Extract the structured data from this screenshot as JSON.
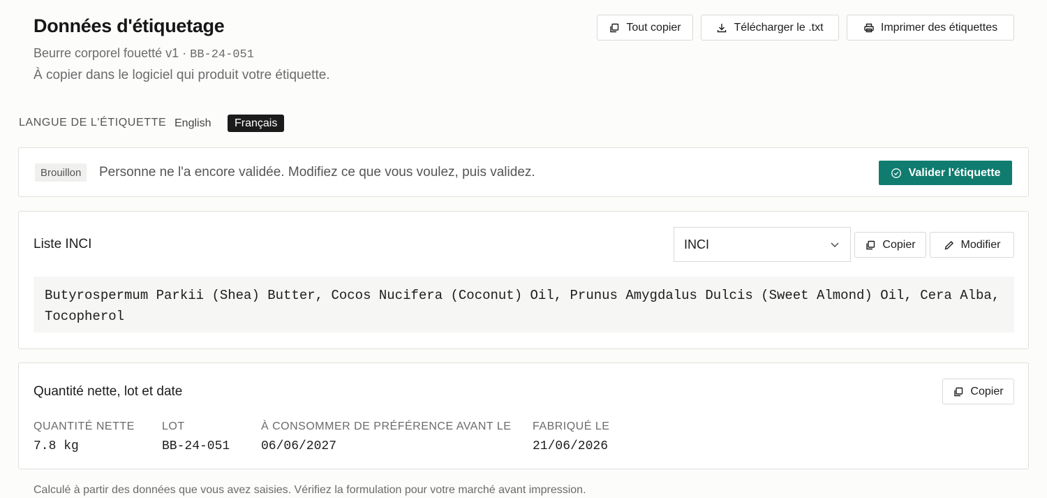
{
  "header": {
    "title": "Données d'étiquetage",
    "subtitle_name": "Beurre corporel fouetté v1 ·",
    "subtitle_code": "BB-24-051",
    "description": "À copier dans le logiciel qui produit votre étiquette."
  },
  "toolbar": {
    "copy_all": "Tout copier",
    "download": "Télécharger le .txt",
    "print": "Imprimer des étiquettes"
  },
  "language": {
    "label": "LANGUE DE L'ÉTIQUETTE",
    "options": [
      "English",
      "Français"
    ],
    "selected": "Français"
  },
  "status": {
    "badge": "Brouillon",
    "message": "Personne ne l'a encore validée. Modifiez ce que vous voulez, puis validez.",
    "validate_label": "Valider l'étiquette"
  },
  "inci": {
    "title": "Liste INCI",
    "select_value": "INCI",
    "copy_label": "Copier",
    "edit_label": "Modifier",
    "list_text": "Butyrospermum Parkii (Shea) Butter, Cocos Nucifera (Coconut) Oil, Prunus Amygdalus Dulcis (Sweet Almond) Oil, Cera Alba, Tocopherol"
  },
  "quantity": {
    "title": "Quantité nette, lot et date",
    "copy_label": "Copier",
    "fields": [
      {
        "label": "QUANTITÉ NETTE",
        "value": "7.8 kg"
      },
      {
        "label": "LOT",
        "value": "BB-24-051"
      },
      {
        "label": "À CONSOMMER DE PRÉFÉRENCE AVANT LE",
        "value": "06/06/2027"
      },
      {
        "label": "FABRIQUÉ LE",
        "value": "21/06/2026"
      }
    ]
  },
  "footnote": "Calculé à partir des données que vous avez saisies. Vérifiez la formulation pour votre marché avant impression.",
  "colors": {
    "accent": "#0f7c6f",
    "active_tab": "#1b1b1b"
  }
}
